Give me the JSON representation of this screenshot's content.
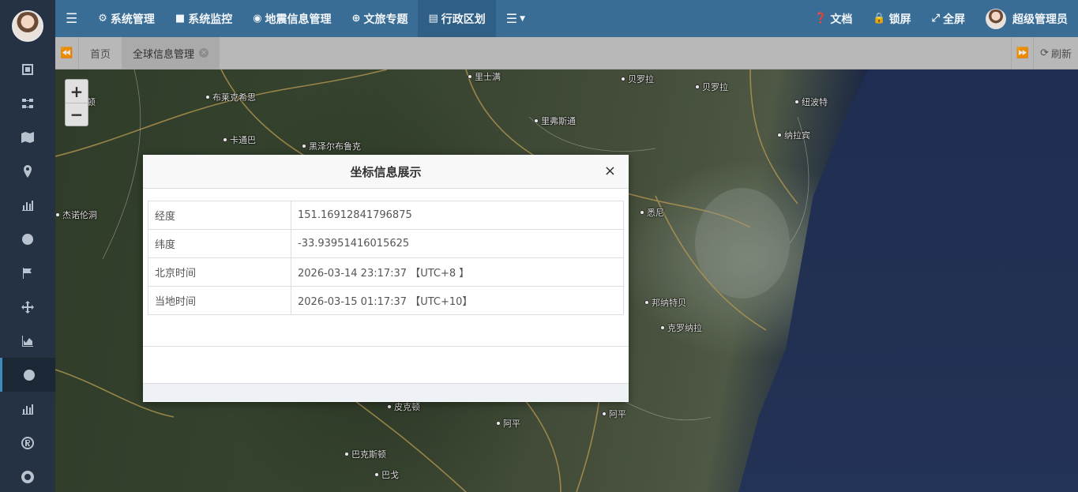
{
  "topnav": {
    "items": [
      {
        "label": "系统管理",
        "icon": "gear-icon"
      },
      {
        "label": "系统监控",
        "icon": "video-camera-icon"
      },
      {
        "label": "地震信息管理",
        "icon": "map-pin-icon"
      },
      {
        "label": "文旅专题",
        "icon": "lifebuoy-icon"
      },
      {
        "label": "行政区划",
        "icon": "bank-icon"
      }
    ],
    "right": {
      "docs": "文档",
      "lock": "锁屏",
      "fullscreen": "全屏",
      "user": "超级管理员"
    }
  },
  "tabbar": {
    "tabs": [
      {
        "label": "首页"
      },
      {
        "label": "全球信息管理"
      }
    ],
    "refresh": "刷新"
  },
  "map": {
    "places": [
      {
        "name": "布莱克希思"
      },
      {
        "name": "卡通巴"
      },
      {
        "name": "黑泽尔布鲁克"
      },
      {
        "name": "杰诺伦洞"
      },
      {
        "name": "里士满"
      },
      {
        "name": "里弗斯通"
      },
      {
        "name": "贝罗拉"
      },
      {
        "name": "贝罗拉"
      },
      {
        "name": "纽波特"
      },
      {
        "name": "纳拉宾"
      },
      {
        "name": "悉尼"
      },
      {
        "name": "邦纳特贝"
      },
      {
        "name": "克罗纳拉"
      },
      {
        "name": "皮克顿"
      },
      {
        "name": "阿平"
      },
      {
        "name": "阿平"
      },
      {
        "name": "巴克斯顿"
      },
      {
        "name": "巴戈"
      },
      {
        "name": "顿"
      }
    ],
    "zoom_in": "+",
    "zoom_out": "−"
  },
  "modal": {
    "title": "坐标信息展示",
    "close": "×",
    "rows": [
      {
        "label": "经度",
        "value": "151.16912841796875"
      },
      {
        "label": "纬度",
        "value": "-33.93951416015625"
      },
      {
        "label": "北京时间",
        "value": "2026-03-14 23:17:37 【UTC+8 】"
      },
      {
        "label": "当地时间",
        "value": "2026-03-15 01:17:37 【UTC+10】"
      }
    ]
  }
}
